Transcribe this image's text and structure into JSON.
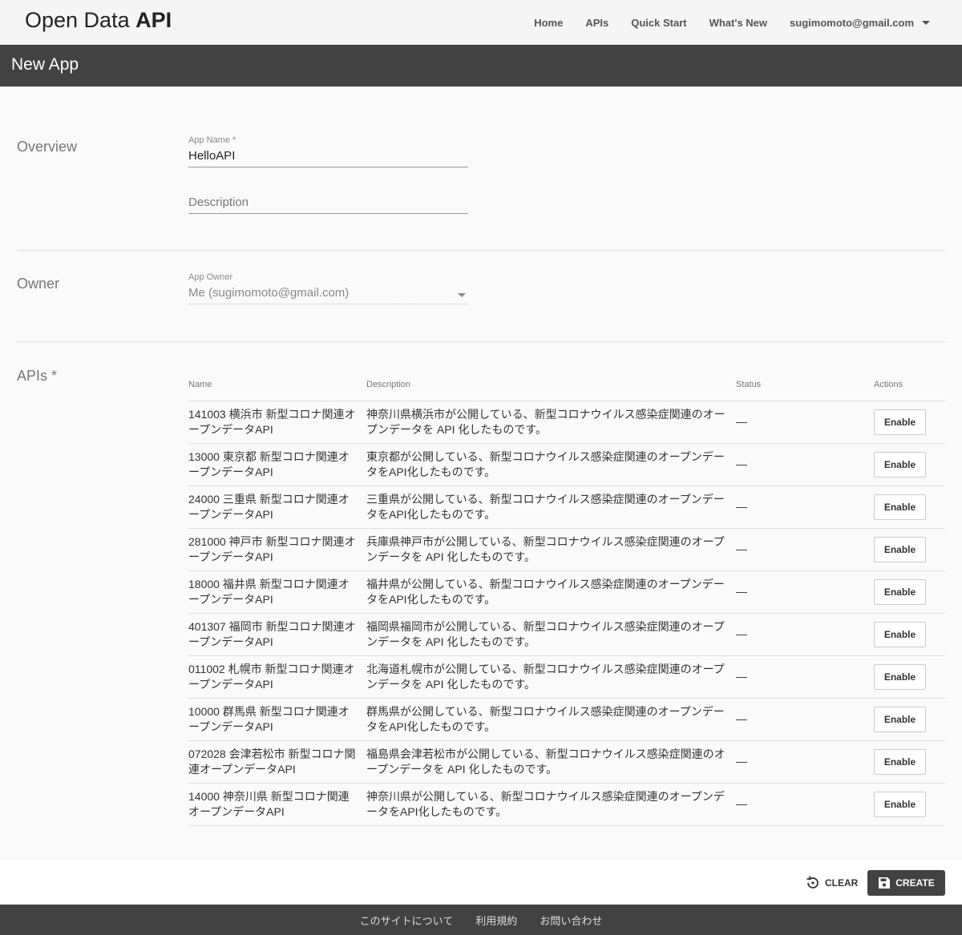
{
  "header": {
    "brand_light": "Open Data",
    "brand_bold": "API",
    "nav": [
      "Home",
      "APIs",
      "Quick Start",
      "What's New"
    ],
    "user": "sugimomoto@gmail.com"
  },
  "page": {
    "title": "New App"
  },
  "overview": {
    "section_label": "Overview",
    "app_name_label": "App Name *",
    "app_name_value": "HelloAPI",
    "description_placeholder": "Description"
  },
  "owner": {
    "section_label": "Owner",
    "app_owner_label": "App Owner",
    "app_owner_value": "Me (sugimomoto@gmail.com)"
  },
  "apis": {
    "section_label": "APIs *",
    "columns": [
      "Name",
      "Description",
      "Status",
      "Actions"
    ],
    "rows": [
      {
        "name": "141003 横浜市 新型コロナ関連オープンデータAPI",
        "description": "神奈川県横浜市が公開している、新型コロナウイルス感染症関連のオープンデータを API 化したものです。",
        "status": "—",
        "action": "Enable"
      },
      {
        "name": "13000 東京都 新型コロナ関連オープンデータAPI",
        "description": "東京都が公開している、新型コロナウイルス感染症関連のオープンデータをAPI化したものです。",
        "status": "—",
        "action": "Enable"
      },
      {
        "name": "24000 三重県 新型コロナ関連オープンデータAPI",
        "description": "三重県が公開している、新型コロナウイルス感染症関連のオープンデータをAPI化したものです。",
        "status": "—",
        "action": "Enable"
      },
      {
        "name": "281000 神戸市 新型コロナ関連オープンデータAPI",
        "description": "兵庫県神戸市が公開している、新型コロナウイルス感染症関連のオープンデータを API 化したものです。",
        "status": "—",
        "action": "Enable"
      },
      {
        "name": "18000 福井県 新型コロナ関連オープンデータAPI",
        "description": "福井県が公開している、新型コロナウイルス感染症関連のオープンデータをAPI化したものです。",
        "status": "—",
        "action": "Enable"
      },
      {
        "name": "401307 福岡市 新型コロナ関連オープンデータAPI",
        "description": "福岡県福岡市が公開している、新型コロナウイルス感染症関連のオープンデータを API 化したものです。",
        "status": "—",
        "action": "Enable"
      },
      {
        "name": "011002 札幌市 新型コロナ関連オープンデータAPI",
        "description": "北海道札幌市が公開している、新型コロナウイルス感染症関連のオープンデータを API 化したものです。",
        "status": "—",
        "action": "Enable"
      },
      {
        "name": "10000 群馬県 新型コロナ関連オープンデータAPI",
        "description": "群馬県が公開している、新型コロナウイルス感染症関連のオープンデータをAPI化したものです。",
        "status": "—",
        "action": "Enable"
      },
      {
        "name": "072028 会津若松市 新型コロナ関連オープンデータAPI",
        "description": "福島県会津若松市が公開している、新型コロナウイルス感染症関連のオープンデータを API 化したものです。",
        "status": "—",
        "action": "Enable"
      },
      {
        "name": "14000 神奈川県 新型コロナ関連オープンデータAPI",
        "description": "神奈川県が公開している、新型コロナウイルス感染症関連のオープンデータをAPI化したものです。",
        "status": "—",
        "action": "Enable"
      }
    ]
  },
  "actions": {
    "clear": "CLEAR",
    "create": "CREATE"
  },
  "footer": {
    "links": [
      "このサイトについて",
      "利用規約",
      "お問い合わせ"
    ]
  }
}
